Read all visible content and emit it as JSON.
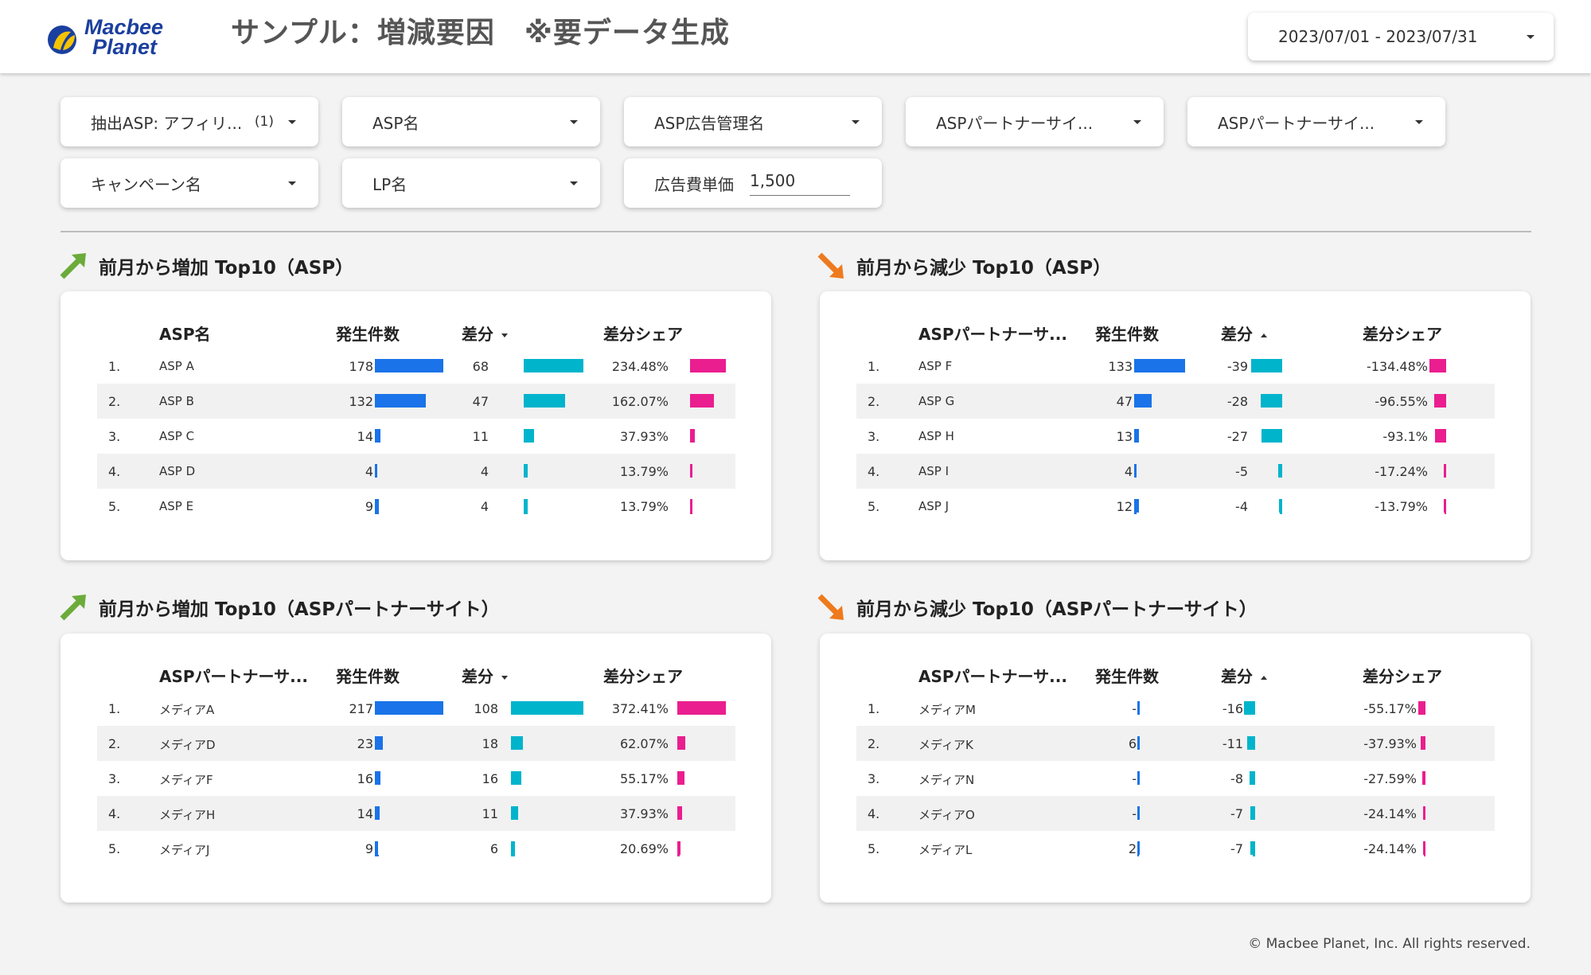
{
  "header": {
    "logo_line1": "Macbee",
    "logo_line2": "Planet",
    "title": "サンプル：増減要因　※要データ生成",
    "date_range": "2023/07/01 - 2023/07/31"
  },
  "filters": {
    "asp_extract": "抽出ASP: アフィリ...",
    "asp_extract_count": "(1)",
    "asp_name": "ASP名",
    "asp_ad_name": "ASP広告管理名",
    "asp_partner1": "ASPパートナーサイ...",
    "asp_partner2": "ASPパートナーサイ...",
    "campaign": "キャンペーン名",
    "lp": "LP名",
    "ad_cost_label": "広告費単価",
    "ad_cost_value": "1,500"
  },
  "sections": {
    "inc_asp_title": "前月から増加 Top10（ASP）",
    "dec_asp_title": "前月から減少 Top10（ASP）",
    "inc_partner_title": "前月から増加 Top10（ASPパートナーサイト）",
    "dec_partner_title": "前月から減少 Top10（ASPパートナーサイト）"
  },
  "tables": {
    "inc_asp": {
      "headers": {
        "name": "ASP名",
        "count": "発生件数",
        "diff": "差分",
        "share": "差分シェア"
      },
      "rows": [
        {
          "rank": "1.",
          "name": "ASP A",
          "count": "178",
          "diff": "68",
          "share": "234.48%"
        },
        {
          "rank": "2.",
          "name": "ASP B",
          "count": "132",
          "diff": "47",
          "share": "162.07%"
        },
        {
          "rank": "3.",
          "name": "ASP C",
          "count": "14",
          "diff": "11",
          "share": "37.93%"
        },
        {
          "rank": "4.",
          "name": "ASP D",
          "count": "4",
          "diff": "4",
          "share": "13.79%"
        },
        {
          "rank": "5.",
          "name": "ASP E",
          "count": "9",
          "diff": "4",
          "share": "13.79%"
        }
      ]
    },
    "dec_asp": {
      "headers": {
        "name": "ASPパートナーサ...",
        "count": "発生件数",
        "diff": "差分",
        "share": "差分シェア"
      },
      "rows": [
        {
          "rank": "1.",
          "name": "ASP F",
          "count": "133",
          "diff": "-39",
          "share": "-134.48%"
        },
        {
          "rank": "2.",
          "name": "ASP G",
          "count": "47",
          "diff": "-28",
          "share": "-96.55%"
        },
        {
          "rank": "3.",
          "name": "ASP H",
          "count": "13",
          "diff": "-27",
          "share": "-93.1%"
        },
        {
          "rank": "4.",
          "name": "ASP I",
          "count": "4",
          "diff": "-5",
          "share": "-17.24%"
        },
        {
          "rank": "5.",
          "name": "ASP J",
          "count": "12",
          "diff": "-4",
          "share": "-13.79%"
        }
      ]
    },
    "inc_partner": {
      "headers": {
        "name": "ASPパートナーサ...",
        "count": "発生件数",
        "diff": "差分",
        "share": "差分シェア"
      },
      "rows": [
        {
          "rank": "1.",
          "name": "メディアA",
          "count": "217",
          "diff": "108",
          "share": "372.41%"
        },
        {
          "rank": "2.",
          "name": "メディアD",
          "count": "23",
          "diff": "18",
          "share": "62.07%"
        },
        {
          "rank": "3.",
          "name": "メディアF",
          "count": "16",
          "diff": "16",
          "share": "55.17%"
        },
        {
          "rank": "4.",
          "name": "メディアH",
          "count": "14",
          "diff": "11",
          "share": "37.93%"
        },
        {
          "rank": "5.",
          "name": "メディアJ",
          "count": "9",
          "diff": "6",
          "share": "20.69%"
        }
      ]
    },
    "dec_partner": {
      "headers": {
        "name": "ASPパートナーサ...",
        "count": "発生件数",
        "diff": "差分",
        "share": "差分シェア"
      },
      "rows": [
        {
          "rank": "1.",
          "name": "メディアM",
          "count": "-",
          "diff": "-16",
          "share": "-55.17%"
        },
        {
          "rank": "2.",
          "name": "メディアK",
          "count": "6",
          "diff": "-11",
          "share": "-37.93%"
        },
        {
          "rank": "3.",
          "name": "メディアN",
          "count": "-",
          "diff": "-8",
          "share": "-27.59%"
        },
        {
          "rank": "4.",
          "name": "メディアO",
          "count": "-",
          "diff": "-7",
          "share": "-24.14%"
        },
        {
          "rank": "5.",
          "name": "メディアL",
          "count": "2",
          "diff": "-7",
          "share": "-24.14%"
        }
      ]
    }
  },
  "footer": "© Macbee Planet, Inc. All rights reserved."
}
